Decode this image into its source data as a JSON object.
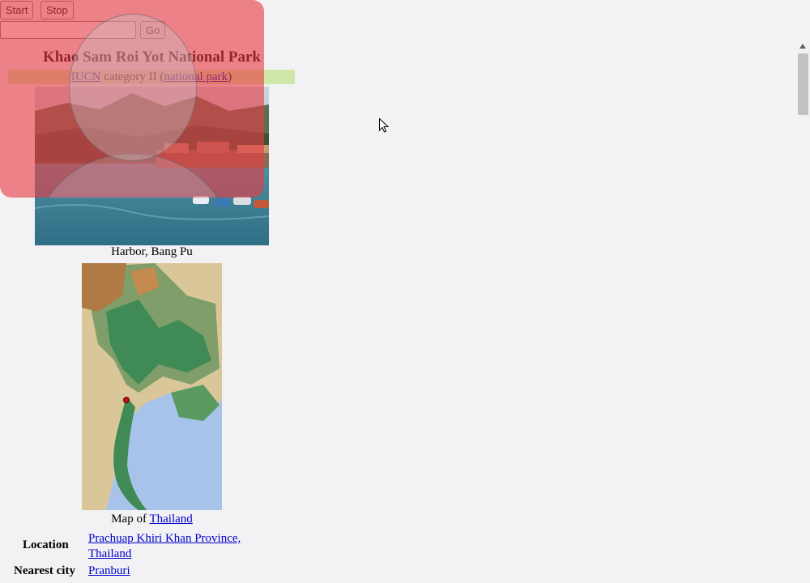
{
  "toolbar": {
    "start_label": "Start",
    "stop_label": "Stop",
    "url_value": "",
    "go_label": "Go"
  },
  "infobox": {
    "title": "Khao Sam Roi Yot National Park",
    "iucn_link": "IUCN",
    "iucn_text": " category II (",
    "iucn_category_link": "national park",
    "iucn_close": ")",
    "photo_caption": "Harbor, Bang Pu",
    "map_caption_prefix": "Map of ",
    "map_caption_link": "Thailand",
    "location_label": "Location",
    "location_value_line1": "Prachuap Khiri Khan Province,",
    "location_value_line2": "Thailand",
    "nearest_city_label": "Nearest city",
    "nearest_city_value": "Pranburi"
  },
  "colors": {
    "overlay": "#e83c46",
    "iucn_background": "#cfe8a8",
    "link": "#0000cc"
  }
}
